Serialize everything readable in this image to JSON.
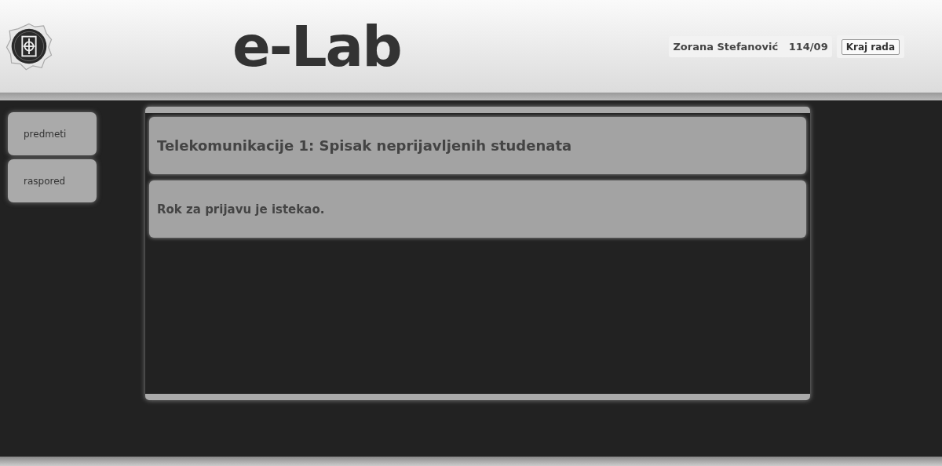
{
  "header": {
    "logo_text": "e-Lab",
    "user": "Zorana Stefanović",
    "index": "114/09",
    "logout": "Kraj rada"
  },
  "sidebar": {
    "items": [
      {
        "label": "predmeti"
      },
      {
        "label": "raspored"
      }
    ]
  },
  "main": {
    "title": "Telekomunikacije 1: Spisak neprijavljenih studenata",
    "message": "Rok za prijavu je istekao."
  }
}
